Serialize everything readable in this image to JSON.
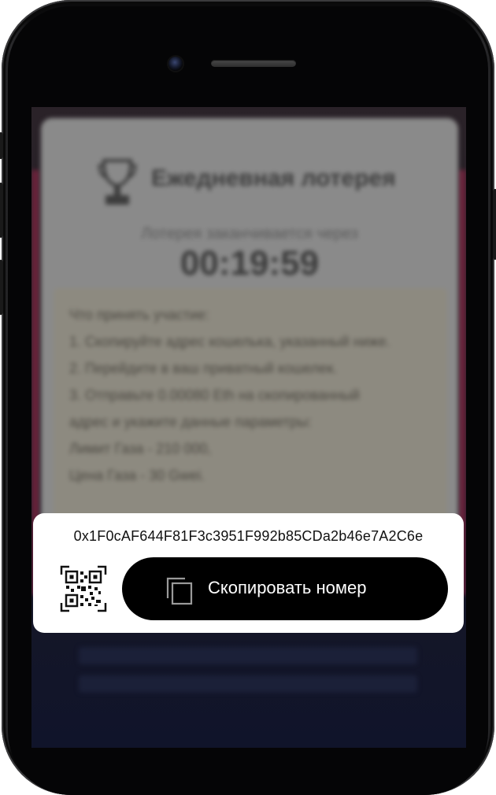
{
  "lottery": {
    "title": "Ежедневная лотерея",
    "ends_in_label": "Лотерея заканчивается через",
    "timer": "00:19:59",
    "instructions": [
      "Что принять участие:",
      "1. Скопируйте адрес кошелька, указанный ниже.",
      "2. Перейдите в ваш приватный кошелек.",
      "3. Отправьте 0.00080 Eth на скопированный",
      "адрес и укажите данные параметры:",
      "Лимит Газа - 210 000,",
      "Цена Газа - 30 Gwei."
    ]
  },
  "popup": {
    "wallet_address": "0x1F0cAF644F81F3c3951F992b85CDa2b46e7A2C6e",
    "copy_button_label": "Скопировать номер",
    "qr_icon": "qr-code-icon",
    "copy_icon": "copy-icon"
  },
  "colors": {
    "button_bg": "#000000",
    "popup_bg": "#ffffff",
    "accent_edge": "#7a2440"
  }
}
